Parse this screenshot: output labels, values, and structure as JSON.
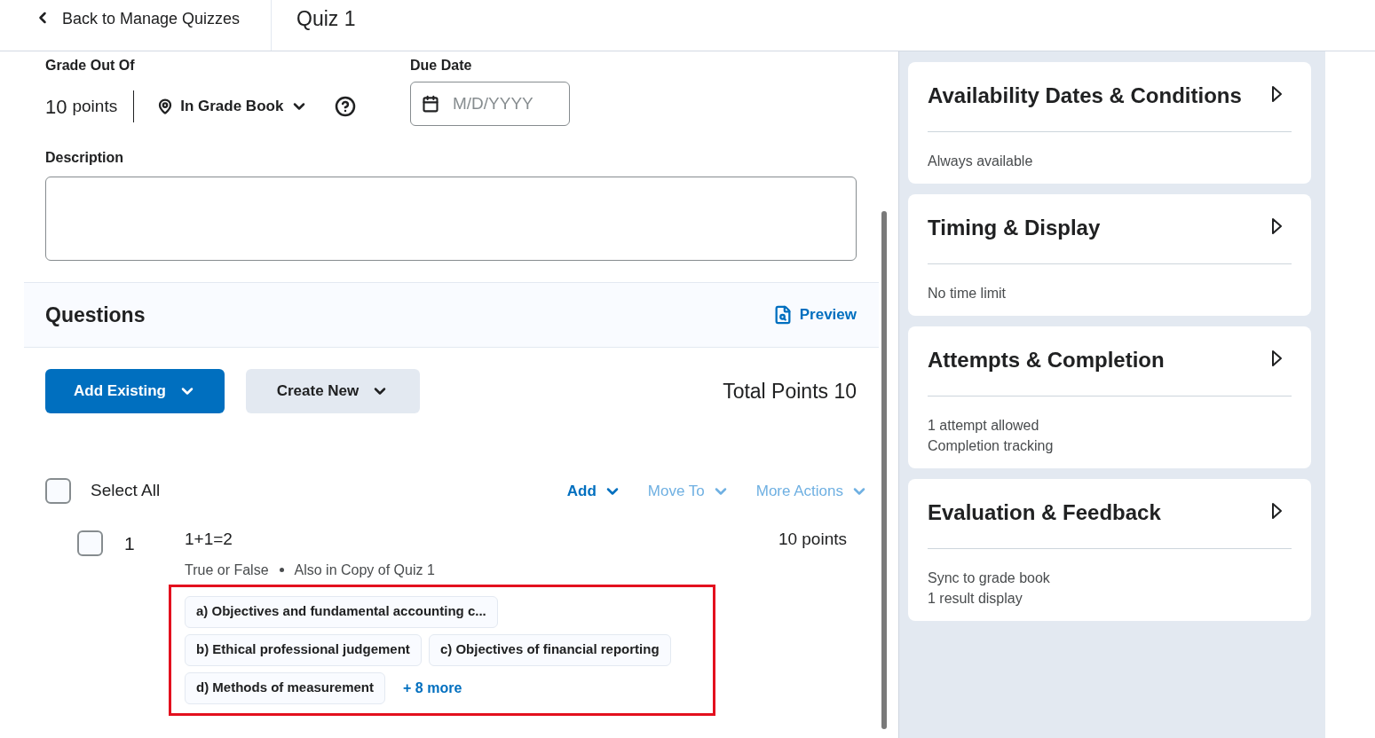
{
  "header": {
    "back_link": "Back to Manage Quizzes",
    "title": "Quiz 1"
  },
  "grade": {
    "label": "Grade Out Of",
    "value": "10",
    "unit": "points",
    "grade_book": "In Grade Book"
  },
  "due_date": {
    "label": "Due Date",
    "placeholder": "M/D/YYYY"
  },
  "description": {
    "label": "Description"
  },
  "questions": {
    "title": "Questions",
    "preview": "Preview",
    "add_existing": "Add Existing",
    "create_new": "Create New",
    "total_points": "Total Points 10",
    "select_all": {
      "label": "Select All",
      "checked": false
    },
    "actions": [
      {
        "label": "Add",
        "disabled": false
      },
      {
        "label": "Move To",
        "disabled": true
      },
      {
        "label": "More Actions",
        "disabled": true
      }
    ],
    "items": [
      {
        "number": "1",
        "text": "1+1=2",
        "points": "10 points",
        "checked": false,
        "type": "True or False",
        "also_in": "Also in Copy of Quiz 1",
        "highlighted": true,
        "outcomes": [
          "a) Objectives and fundamental accounting c...",
          "b) Ethical professional judgement",
          "c) Objectives of financial reporting",
          "d) Methods of measurement"
        ],
        "more": "+ 8 more"
      }
    ]
  },
  "panels": [
    {
      "title": "Availability Dates & Conditions",
      "lines": [
        "Always available"
      ]
    },
    {
      "title": "Timing & Display",
      "lines": [
        "No time limit"
      ]
    },
    {
      "title": "Attempts & Completion",
      "lines": [
        "1 attempt allowed",
        "Completion tracking"
      ]
    },
    {
      "title": "Evaluation & Feedback",
      "lines": [
        "Sync to grade book",
        "1 result display"
      ]
    }
  ]
}
